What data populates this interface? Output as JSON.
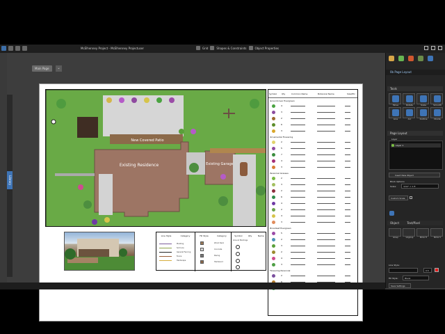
{
  "app": {
    "title": "McElhenney Project - McElhenney Projectuser",
    "sheet_tab": "Main Page",
    "library_label": "Library",
    "toolbar_menu": [
      "Grid",
      "Shapes & Constraints",
      "Object Properties"
    ]
  },
  "drawing": {
    "patio_label": "New Covered Patio",
    "residence_label": "Existing Residence",
    "garage_label": "Existing Garage"
  },
  "legend": {
    "headers": [
      "Symbol",
      "Qty",
      "Common Name",
      "Botanical Name",
      "Size/Etc"
    ],
    "sections": [
      "Groundcover Evergreen",
      "Ornamental Flowering",
      "Perennial Grasses",
      "Broadleaf Evergreen",
      "Flowering Perennial"
    ],
    "rows": [
      {
        "color": "#4aa340",
        "qty": "4"
      },
      {
        "color": "#8c4c9f",
        "qty": "3"
      },
      {
        "color": "#9c6a2f",
        "qty": "2"
      },
      {
        "color": "#5c8d2a",
        "qty": "6"
      },
      {
        "color": "#d9a72b",
        "qty": "3"
      },
      {
        "color": "#e1d36b",
        "qty": "2"
      },
      {
        "color": "#8f4aa0",
        "qty": "5"
      },
      {
        "color": "#3b8d3e",
        "qty": "7"
      },
      {
        "color": "#a52f78",
        "qty": "4"
      },
      {
        "color": "#d97f35",
        "qty": "3"
      },
      {
        "color": "#79b844",
        "qty": "2"
      },
      {
        "color": "#a3c060",
        "qty": "3"
      },
      {
        "color": "#8d2f3e",
        "qty": "2"
      },
      {
        "color": "#2f8d4b",
        "qty": "6"
      },
      {
        "color": "#6f3aa5",
        "qty": "4"
      },
      {
        "color": "#6aa34b",
        "qty": "2"
      },
      {
        "color": "#d6c44b",
        "qty": "4"
      },
      {
        "color": "#e18c5c",
        "qty": "3"
      },
      {
        "color": "#9b4ca7",
        "qty": "5"
      },
      {
        "color": "#4c93b8",
        "qty": "2"
      },
      {
        "color": "#5aa03a",
        "qty": "3"
      },
      {
        "color": "#9b8b2d",
        "qty": "2"
      },
      {
        "color": "#ce4c8f",
        "qty": "4"
      },
      {
        "color": "#4e9f45",
        "qty": "3"
      },
      {
        "color": "#7b4f9e",
        "qty": "2"
      },
      {
        "color": "#b37b2a",
        "qty": "6"
      },
      {
        "color": "#4fa95c",
        "qty": "3"
      }
    ]
  },
  "bottom_legend": {
    "line_style_heading": "Line Style",
    "category_heading": "Category",
    "fill_heading": "Fill Style",
    "symbol_heading": "Symbol",
    "qty_heading": "Qty",
    "name_heading": "Name",
    "line_items": [
      "Planting",
      "Sod Line",
      "General Fencing",
      "Fence",
      "Hardscape"
    ],
    "fill_items": [
      "Wood Deck",
      "Concrete",
      "Paving",
      "Hardwood"
    ],
    "symbol_title": "Ground Markings"
  },
  "right_panel": {
    "title": "0b Page Layout",
    "tools_heading": "Tools",
    "tools": [
      "Move",
      "Rotate",
      "Scale",
      "Smooth",
      "Line",
      "Arc",
      "Outline",
      "Divide"
    ],
    "page_layout_heading": "Page Layout",
    "layer_heading": "Layer",
    "layer_item": "Layer 1",
    "insert_button": "Insert New Object",
    "block_options": "Block Options",
    "scale_label": "Scale:",
    "scale_value": "3/32\" = 1 ft",
    "custom_scale": "Custom Scale",
    "object_tab": "Object",
    "text_tab": "Text/Pixel",
    "object_tools": [
      "Group",
      "Ungroup",
      "Mirror H",
      "Mirror V"
    ],
    "line_style_label": "Line Style:",
    "line_width": "0.5",
    "fill_style_label": "Fill Style:",
    "fill_value": "Blank",
    "save_label": "Save Settings"
  },
  "colors": {
    "accent": "#3e74b6",
    "grass": "#67a844",
    "house": "#9d7564",
    "deck": "#8c6a4a",
    "panel": "#252525"
  }
}
